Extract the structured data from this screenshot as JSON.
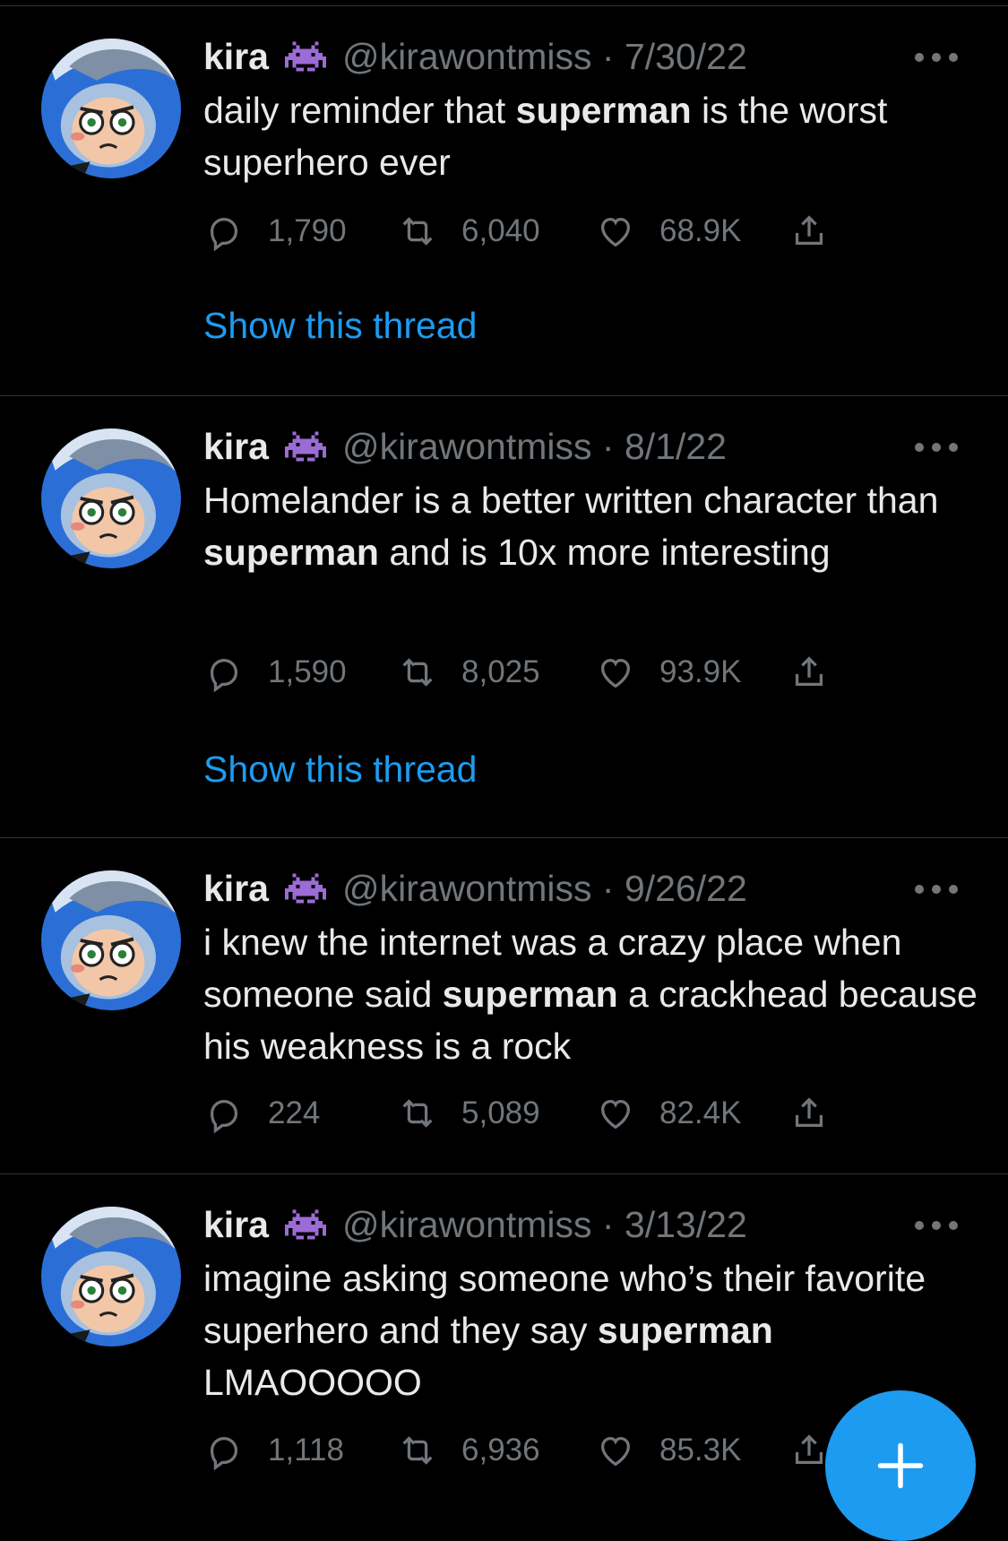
{
  "tweets": [
    {
      "name": "kira",
      "handle": "@kirawontmiss",
      "date": "7/30/22",
      "body_parts": [
        {
          "text": "daily reminder that ",
          "bold": false
        },
        {
          "text": "superman",
          "bold": true
        },
        {
          "text": " is the worst superhero ever",
          "bold": false
        }
      ],
      "replies": "1,790",
      "retweets": "6,040",
      "likes": "68.9K",
      "thread_link": "Show this thread"
    },
    {
      "name": "kira",
      "handle": "@kirawontmiss",
      "date": "8/1/22",
      "body_parts": [
        {
          "text": "Homelander is a better written character than ",
          "bold": false
        },
        {
          "text": "superman",
          "bold": true
        },
        {
          "text": " and is 10x more interesting",
          "bold": false
        }
      ],
      "replies": "1,590",
      "retweets": "8,025",
      "likes": "93.9K",
      "thread_link": "Show this thread"
    },
    {
      "name": "kira",
      "handle": "@kirawontmiss",
      "date": "9/26/22",
      "body_parts": [
        {
          "text": "i knew the internet was a crazy place when someone said ",
          "bold": false
        },
        {
          "text": "superman",
          "bold": true
        },
        {
          "text": " a crackhead because his weakness is a rock",
          "bold": false
        }
      ],
      "replies": "224",
      "retweets": "5,089",
      "likes": "82.4K",
      "thread_link": ""
    },
    {
      "name": "kira",
      "handle": "@kirawontmiss",
      "date": "3/13/22",
      "body_parts": [
        {
          "text": "imagine asking someone who’s their favorite superhero and they say ",
          "bold": false
        },
        {
          "text": "superman",
          "bold": true
        },
        {
          "text": " LMAOOOOO",
          "bold": false
        }
      ],
      "replies": "1,118",
      "retweets": "6,936",
      "likes": "85.3K",
      "thread_link": ""
    }
  ],
  "icons": {
    "badge": "alien-monster-icon",
    "reply": "reply-icon",
    "retweet": "retweet-icon",
    "like": "heart-icon",
    "share": "share-icon",
    "more": "more-dots-icon",
    "compose": "plus-icon"
  },
  "colors": {
    "background": "#000000",
    "text": "#e7e9ea",
    "muted": "#71767b",
    "accent": "#1d9bf0",
    "badge": "#9b6cd6"
  }
}
